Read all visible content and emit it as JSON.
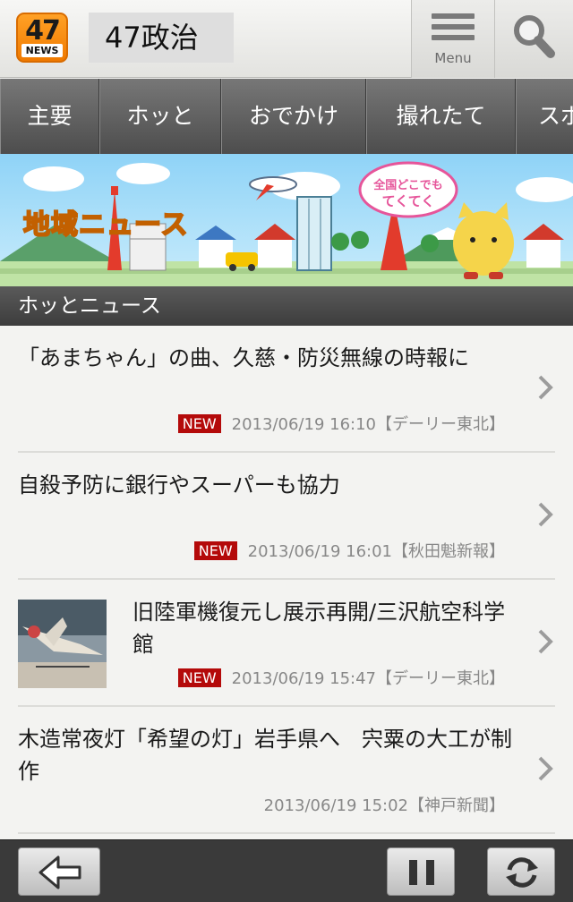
{
  "header": {
    "logo_number": "47",
    "logo_sub": "NEWS",
    "title": "47政治",
    "menu_label": "Menu"
  },
  "tabs": [
    "主要",
    "ホッと",
    "おでかけ",
    "撮れたて",
    "スポ"
  ],
  "banner": {
    "title": "地域ニュース",
    "bubble_line1": "全国どこでも",
    "bubble_line2": "てくてく"
  },
  "section_title": "ホッとニュース",
  "articles": [
    {
      "headline": "「あまちゃん」の曲、久慈・防災無線の時報に",
      "is_new": true,
      "new_label": "NEW",
      "datetime": "2013/06/19 16:10",
      "source": "【デーリー東北】",
      "has_image": false
    },
    {
      "headline": "自殺予防に銀行やスーパーも協力",
      "is_new": true,
      "new_label": "NEW",
      "datetime": "2013/06/19 16:01",
      "source": "【秋田魁新報】",
      "has_image": false
    },
    {
      "headline": "旧陸軍機復元し展示再開/三沢航空科学館",
      "is_new": true,
      "new_label": "NEW",
      "datetime": "2013/06/19 15:47",
      "source": "【デーリー東北】",
      "has_image": true
    },
    {
      "headline": "木造常夜灯「希望の灯」岩手県へ　宍粟の大工が制作",
      "is_new": false,
      "new_label": "",
      "datetime": "2013/06/19 15:02",
      "source": "【神戸新聞】",
      "has_image": false
    }
  ],
  "bottom_bar": {
    "back_icon": "arrow-left-icon",
    "pause_icon": "pause-icon",
    "refresh_icon": "refresh-icon"
  },
  "colors": {
    "logo_orange": "#f58a0b",
    "tab_bar": "#5a5a5a",
    "new_badge": "#b40a0a",
    "bottom_bar": "#3a3a3a"
  }
}
